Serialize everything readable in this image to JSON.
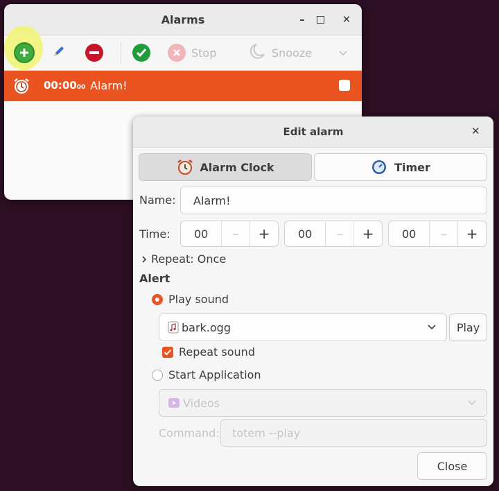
{
  "main_window": {
    "title": "Alarms",
    "toolbar": {
      "add_icon": "plus-circle-icon",
      "edit_icon": "pencil-icon",
      "remove_icon": "minus-circle-icon",
      "confirm_icon": "check-circle-icon",
      "stop_label": "Stop",
      "snooze_label": "Snooze"
    },
    "alarms": [
      {
        "time_main": "00:00",
        "time_sub": "00",
        "name": "Alarm!",
        "checked": false
      }
    ]
  },
  "edit_dialog": {
    "title": "Edit alarm",
    "tabs": [
      {
        "label": "Alarm Clock",
        "active": true
      },
      {
        "label": "Timer",
        "active": false
      }
    ],
    "name_label": "Name:",
    "name_value": "Alarm!",
    "time_label": "Time:",
    "time": {
      "hours": "00",
      "minutes": "00",
      "seconds": "00"
    },
    "repeat_label": "Repeat: Once",
    "alert_heading": "Alert",
    "play_sound_label": "Play sound",
    "sound_file": "bark.ogg",
    "play_button": "Play",
    "repeat_sound_label": "Repeat sound",
    "start_app_label": "Start Application",
    "app_name": "Videos",
    "command_label": "Command:",
    "command_value": "totem --play",
    "close_button": "Close"
  },
  "colors": {
    "accent": "#e95420",
    "add_green": "#3dab3d",
    "remove_red": "#c7162b",
    "highlight": "#f2f47a"
  }
}
